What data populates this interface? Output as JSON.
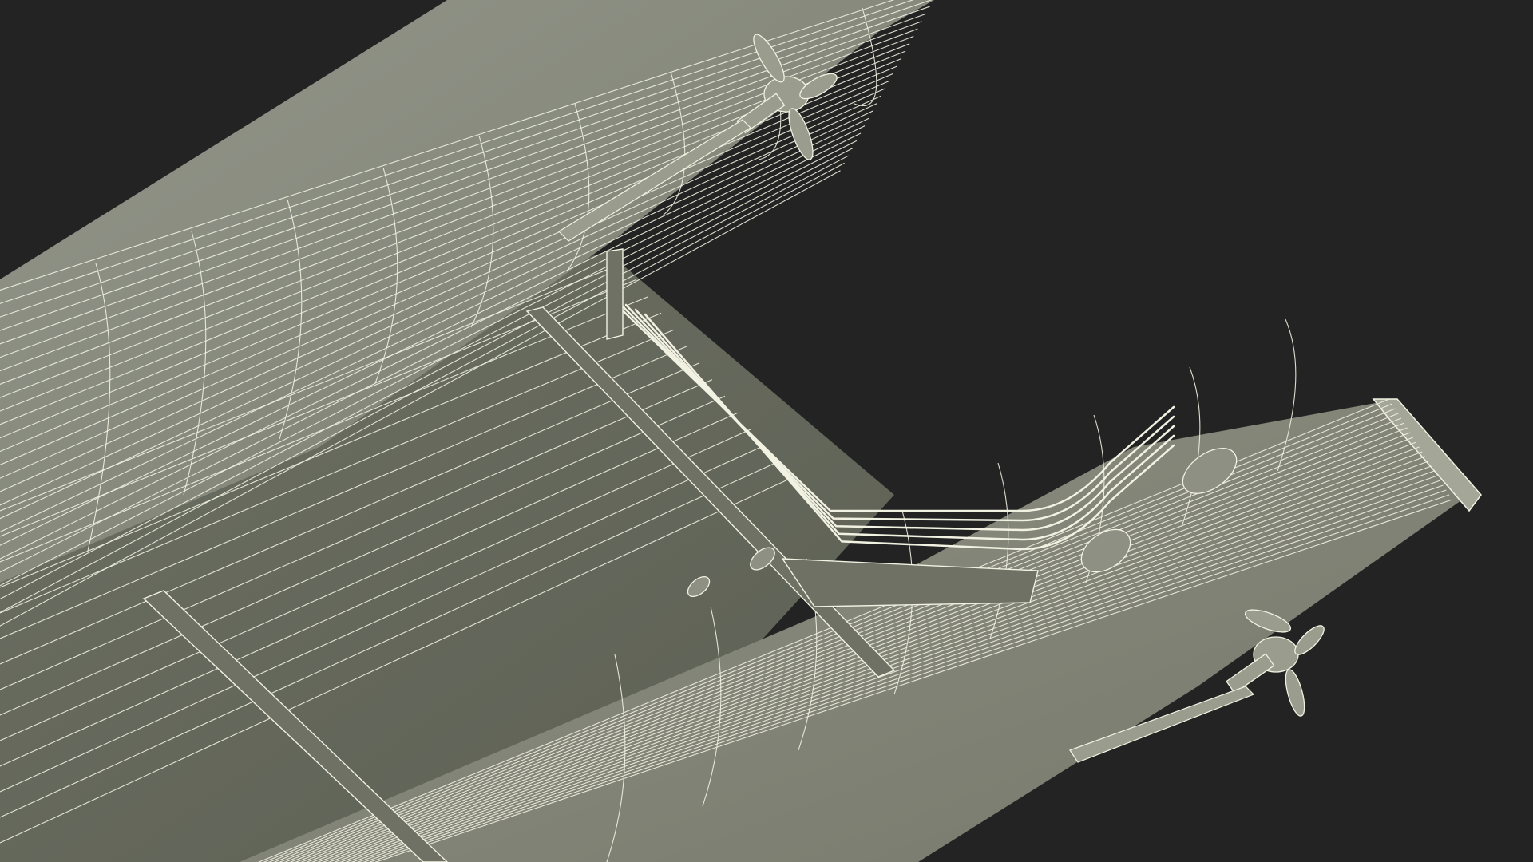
{
  "scene": {
    "background_color": "#232323",
    "surface_color_light": "#8f9182",
    "surface_color_mid": "#7d8071",
    "surface_color_dark": "#606356",
    "wire_color": "#f2f2e2",
    "subject": "wireframe-3d-model-underside"
  }
}
